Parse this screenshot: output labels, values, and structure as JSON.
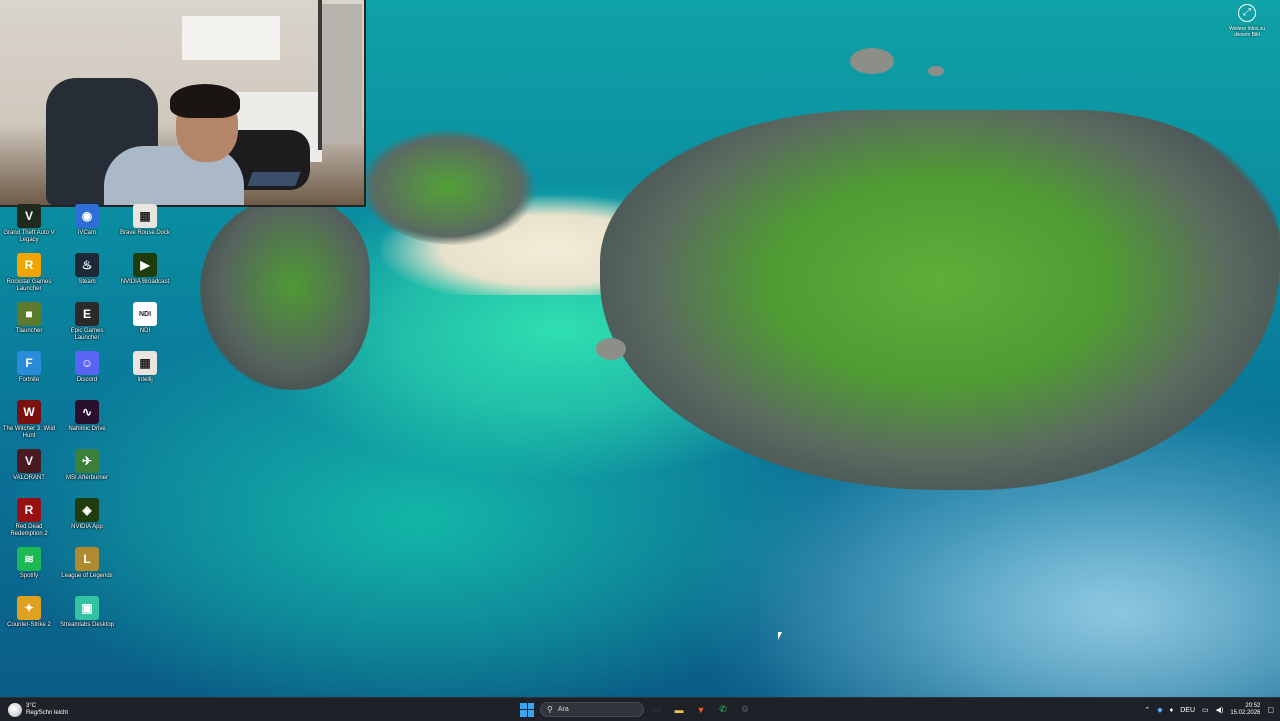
{
  "desktop_icons": [
    {
      "label": "Grand Theft Auto V Legacy",
      "icon": "gta-icon",
      "color": "#1f2a1d",
      "glyph": "V"
    },
    {
      "label": "iVCam",
      "icon": "camera-icon",
      "color": "#2d6fd6",
      "glyph": "◉"
    },
    {
      "label": "Rockstar Games Launcher",
      "icon": "rockstar-icon",
      "color": "#f0a500",
      "glyph": "R"
    },
    {
      "label": "Steam",
      "icon": "steam-icon",
      "color": "#1b2838",
      "glyph": "♨"
    },
    {
      "label": "Tlauncher",
      "icon": "minecraft-icon",
      "color": "#5b7a2e",
      "glyph": "■"
    },
    {
      "label": "Epic Games Launcher",
      "icon": "epic-icon",
      "color": "#2a2a2a",
      "glyph": "E"
    },
    {
      "label": "Fortnite",
      "icon": "fortnite-icon",
      "color": "#2a8bd8",
      "glyph": "F"
    },
    {
      "label": "Discord",
      "icon": "discord-icon",
      "color": "#5865f2",
      "glyph": "☺"
    },
    {
      "label": "The Witcher 3: Wild Hunt",
      "icon": "witcher-icon",
      "color": "#7a1010",
      "glyph": "W"
    },
    {
      "label": "Nahimic Drive",
      "icon": "audio-icon",
      "color": "#2a0f2f",
      "glyph": "∿"
    },
    {
      "label": "VALORANT",
      "icon": "valorant-icon",
      "color": "#4a1a22",
      "glyph": "V"
    },
    {
      "label": "MSI Afterburner",
      "icon": "afterburner-icon",
      "color": "#3a7f3a",
      "glyph": "✈"
    },
    {
      "label": "Red Dead Redemption 2",
      "icon": "rdr2-icon",
      "color": "#9a1010",
      "glyph": "R"
    },
    {
      "label": "NVIDIA App",
      "icon": "nvidia-icon",
      "color": "#1f3d0c",
      "glyph": "◈"
    },
    {
      "label": "Spotify",
      "icon": "spotify-icon",
      "color": "#1db954",
      "glyph": "≋"
    },
    {
      "label": "League of Legends",
      "icon": "lol-icon",
      "color": "#b08a30",
      "glyph": "L"
    },
    {
      "label": "Counter-Strike 2",
      "icon": "cs2-icon",
      "color": "#e0a020",
      "glyph": "✦"
    },
    {
      "label": "Streamlabs Desktop",
      "icon": "streamlabs-icon",
      "color": "#31c3a2",
      "glyph": "▣"
    }
  ],
  "extra_icons": [
    {
      "label": "Brave Rouse Dock",
      "icon": "doc-icon",
      "color": "#e9e4de",
      "glyph": "▦"
    },
    {
      "label": "NVIDIA Broadcast",
      "icon": "broadcast-icon",
      "color": "#1f3d0c",
      "glyph": "▶"
    },
    {
      "label": "NDI",
      "icon": "ndi-icon",
      "color": "#ffffff",
      "glyph": "NDI"
    },
    {
      "label": "Intellij",
      "icon": "intellij-icon",
      "color": "#e9e4de",
      "glyph": "▦"
    }
  ],
  "widget": {
    "icon": "widget-icon",
    "text": "Weitere Infos zu diesem Bild"
  },
  "taskbar": {
    "weather_temp": "3°C",
    "weather_text": "Reg/Schn leicht",
    "search_placeholder": "Ara",
    "apps": [
      {
        "icon": "task-view-icon",
        "glyph": "▭",
        "color": "#3a3f46"
      },
      {
        "icon": "file-explorer-icon",
        "glyph": "▬",
        "color": "#f2c14e"
      },
      {
        "icon": "brave-icon",
        "glyph": "▼",
        "color": "#fb542b"
      },
      {
        "icon": "whatsapp-icon",
        "glyph": "✆",
        "color": "#25d366"
      },
      {
        "icon": "settings-icon",
        "glyph": "⚙",
        "color": "#5a5f66"
      }
    ],
    "language": "DEU",
    "time": "20:52",
    "date": "15.02.2026"
  }
}
